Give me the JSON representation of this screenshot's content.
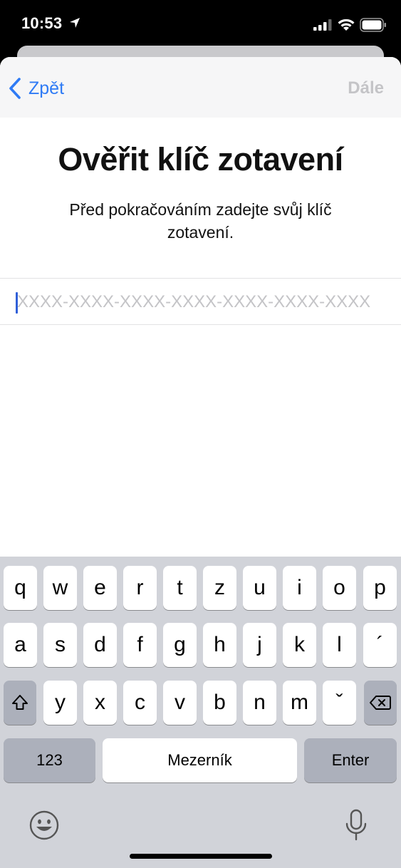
{
  "status_bar": {
    "time": "10:53"
  },
  "nav": {
    "back_label": "Zpět",
    "next_label": "Dále"
  },
  "content": {
    "title": "Ověřit klíč zotavení",
    "subtitle": "Před pokračováním zadejte svůj klíč zotavení.",
    "key_input": {
      "value": "",
      "placeholder": "XXXX-XXXX-XXXX-XXXX-XXXX-XXXX-XXXX"
    }
  },
  "keyboard": {
    "row1": [
      "q",
      "w",
      "e",
      "r",
      "t",
      "z",
      "u",
      "i",
      "o",
      "p"
    ],
    "row2": [
      "a",
      "s",
      "d",
      "f",
      "g",
      "h",
      "j",
      "k",
      "l",
      "´"
    ],
    "row3": [
      "y",
      "x",
      "c",
      "v",
      "b",
      "n",
      "m",
      "ˇ"
    ],
    "numbers_label": "123",
    "space_label": "Mezerník",
    "enter_label": "Enter",
    "icons": {
      "shift": "shift-icon",
      "backspace": "backspace-icon",
      "emoji": "emoji-icon",
      "mic": "microphone-icon"
    }
  },
  "colors": {
    "accent": "#2f7bf5",
    "disabled": "#c4c4c7",
    "keyboard_bg": "#d1d3d9",
    "dark_key": "#acb0bb"
  }
}
